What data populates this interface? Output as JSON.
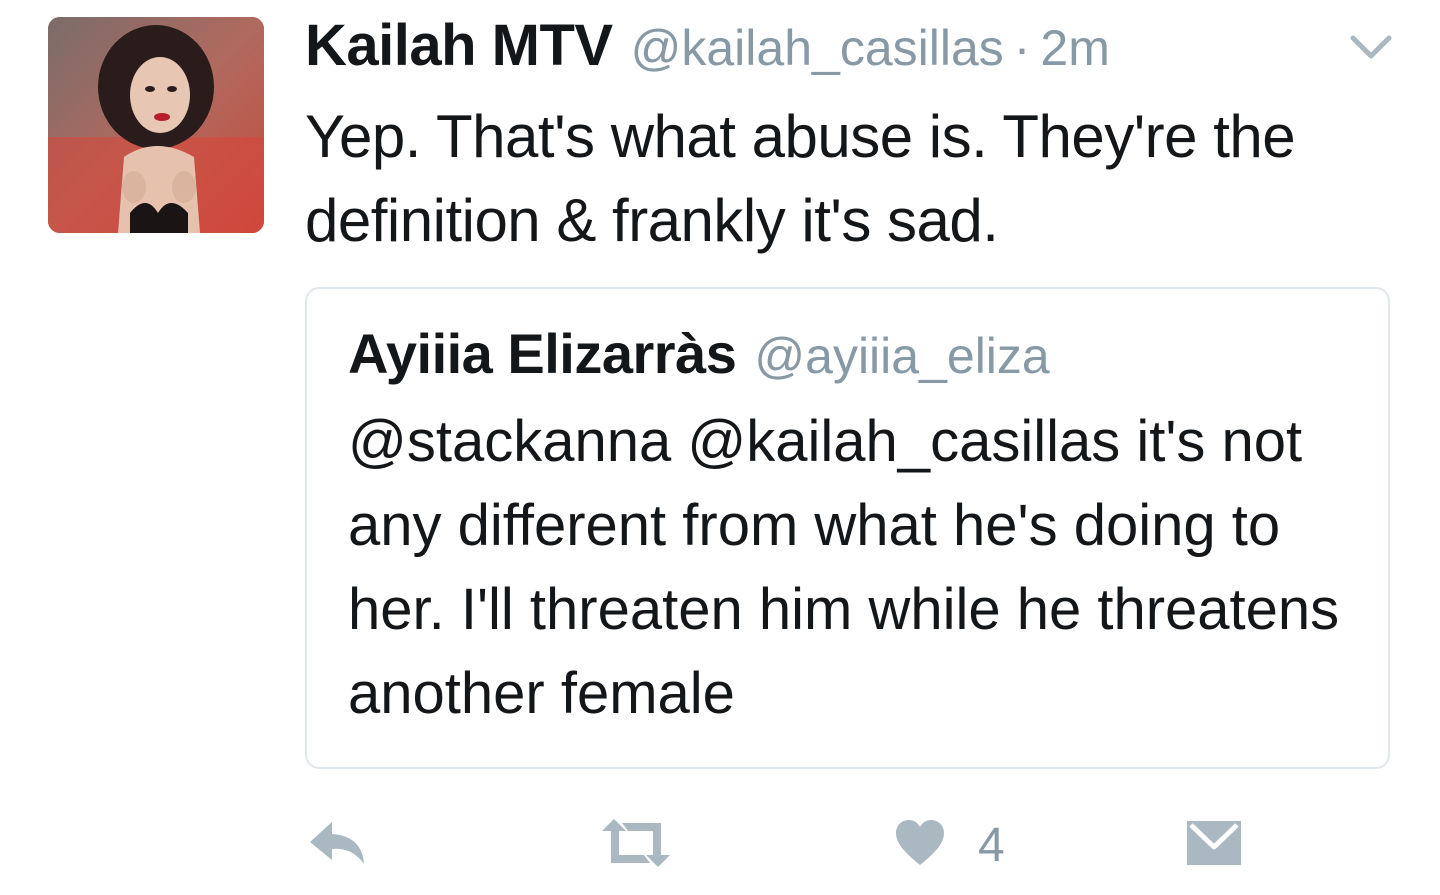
{
  "tweet": {
    "author_name": "Kailah MTV",
    "author_handle": "@kailah_casillas",
    "separator": "·",
    "time": "2m",
    "text": "Yep. That's what abuse is. They're the definition & frankly it's sad."
  },
  "quoted_tweet": {
    "author_name": "Ayiiia Elizarràs",
    "author_handle": "@ayiiia_eliza",
    "text": "@stackanna @kailah_casillas it's not any different from what he's doing to her. I'll threaten him while he threatens another female"
  },
  "actions": {
    "reply_icon": "reply-icon",
    "retweet_icon": "retweet-icon",
    "like_icon": "heart-icon",
    "like_count": "4",
    "dm_icon": "envelope-icon"
  },
  "colors": {
    "text_primary": "#14171a",
    "text_secondary": "#8899a6",
    "border": "#e1e8ed",
    "icon": "#aab8c2"
  }
}
